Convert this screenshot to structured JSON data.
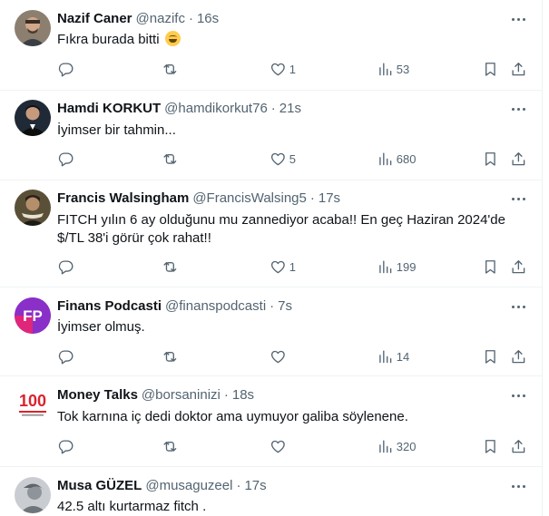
{
  "tweets": [
    {
      "name": "Nazif Caner",
      "handle": "@nazifc",
      "sep": "·",
      "time": "16s",
      "text": "Fıkra burada bitti",
      "emoji": "grinning-squinting-face",
      "likes": "1",
      "views": "53",
      "avatar_color": "#9a8a78"
    },
    {
      "name": "Hamdi KORKUT",
      "handle": "@hamdikorkut76",
      "sep": "·",
      "time": "21s",
      "text": "İyimser bir tahmin...",
      "likes": "5",
      "views": "680",
      "avatar_color": "#1c2530"
    },
    {
      "name": "Francis Walsingham",
      "handle": "@FrancisWalsing5",
      "sep": "·",
      "time": "17s",
      "text": "FITCH yılın 6 ay olduğunu mu zannediyor acaba!! En geç Haziran 2024'de $/TL 38'i görür çok rahat!!",
      "likes": "1",
      "views": "199",
      "avatar_color": "#6b6048"
    },
    {
      "name": "Finans Podcasti",
      "handle": "@finanspodcasti",
      "sep": "·",
      "time": "7s",
      "text": "İyimser olmuş.",
      "likes": "",
      "views": "14",
      "avatar_color": "#7b2fbe",
      "avatar_letters": "FP"
    },
    {
      "name": "Money Talks",
      "handle": "@borsaninizi",
      "sep": "·",
      "time": "18s",
      "text": "Tok karnına iç dedi doktor ama uymuyor galiba söylenene.",
      "likes": "",
      "views": "320",
      "avatar_color": "#d9232e",
      "avatar_letters": "100"
    },
    {
      "name": "Musa GÜZEL",
      "handle": "@musaguzeel",
      "sep": "·",
      "time": "17s",
      "text": "42.5 altı kurtarmaz fitch .",
      "likes": "",
      "views": "",
      "avatar_color": "#c9cdd1"
    }
  ],
  "icons": {
    "reply": "reply-icon",
    "retweet": "retweet-icon",
    "like": "heart-icon",
    "views": "views-icon",
    "bookmark": "bookmark-icon",
    "share": "share-icon",
    "more": "more-icon"
  },
  "colors": {
    "text": "#0f1419",
    "secondary": "#536471",
    "border": "#eff3f4"
  }
}
